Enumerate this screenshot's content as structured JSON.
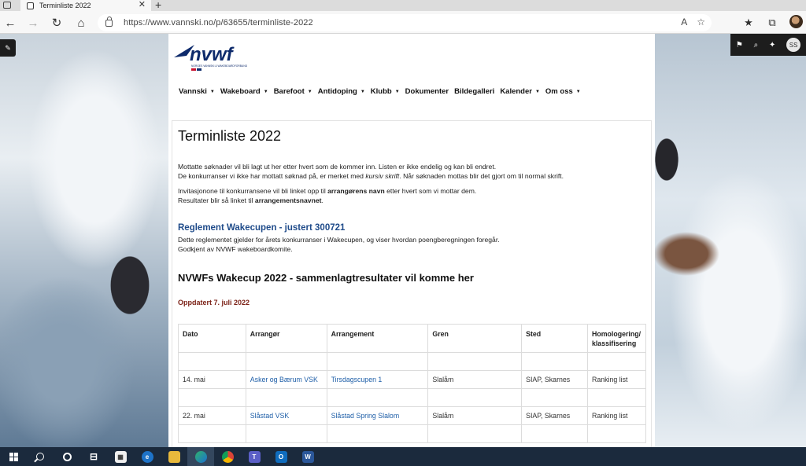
{
  "browser": {
    "tab_title": "Terminliste 2022",
    "url": "https://www.vannski.no/p/63655/terminliste-2022",
    "font_icon": "A⁠a"
  },
  "wp": {
    "avatar_initials": "SS"
  },
  "nav": {
    "items": [
      {
        "label": "Vannski",
        "dropdown": true
      },
      {
        "label": "Wakeboard",
        "dropdown": true
      },
      {
        "label": "Barefoot",
        "dropdown": true
      },
      {
        "label": "Antidoping",
        "dropdown": true
      },
      {
        "label": "Klubb",
        "dropdown": true
      },
      {
        "label": "Dokumenter",
        "dropdown": false
      },
      {
        "label": "Bildegalleri",
        "dropdown": false
      },
      {
        "label": "Kalender",
        "dropdown": true
      },
      {
        "label": "Om oss",
        "dropdown": true
      }
    ]
  },
  "logo": {
    "text": "nvwf",
    "subtitle": "NORGES VANNSKI & WAKEBOARDFORBUND"
  },
  "content": {
    "title": "Terminliste 2022",
    "p1_line1": "Mottatte søknader vil bli lagt ut her etter hvert som de kommer inn. Listen er ikke endelig og kan bli endret.",
    "p1_line2a": "De konkurranser vi ikke har mottatt søknad på, er merket med ",
    "p1_line2_italic": "kursiv skrift",
    "p1_line2b": ".  Når søknaden mottas blir det gjort om til normal skrift.",
    "p2_line1a": "Invitasjonone til konkurransene vil bli linket opp til ",
    "p2_line1_bold": "arrangørens navn",
    "p2_line1b": " etter hvert som vi mottar dem.",
    "p2_line2a": "Resultater blir så linket til ",
    "p2_line2_bold": "arrangementsnavnet",
    "p2_line2b": ".",
    "reglement_link": "Reglement Wakecupen - justert 300721",
    "p3_line1": "Dette reglementet gjelder for årets konkurranser i Wakecupen, og viser hvordan poengberegningen foregår.",
    "p3_line2": "Godkjent av NVWF wakeboardkomite.",
    "wakecup_heading": "NVWFs Wakecup 2022 - sammenlagtresultater vil komme her",
    "updated": "Oppdatert 7. juli 2022"
  },
  "table": {
    "headers": [
      "Dato",
      "Arrangør",
      "Arrangement",
      "Gren",
      "Sted",
      "Homologering/ klassifisering"
    ],
    "rows": [
      {
        "dato": "14. mai",
        "arrangor": "Asker og Bærum VSK",
        "arrangement": "Tirsdagscupen 1",
        "gren": "Slalåm",
        "sted": "SIAP, Skarnes",
        "hom": "Ranking list"
      },
      {
        "dato": "22. mai",
        "arrangor": "Slåstad VSK",
        "arrangement": "Slåstad Spring Slalom",
        "gren": "Slalåm",
        "sted": "SIAP, Skarnes",
        "hom": "Ranking list"
      }
    ]
  },
  "colors": {
    "link": "#1f4b8a",
    "updated": "#7a1f14",
    "taskbar": "#1b2a3d"
  }
}
